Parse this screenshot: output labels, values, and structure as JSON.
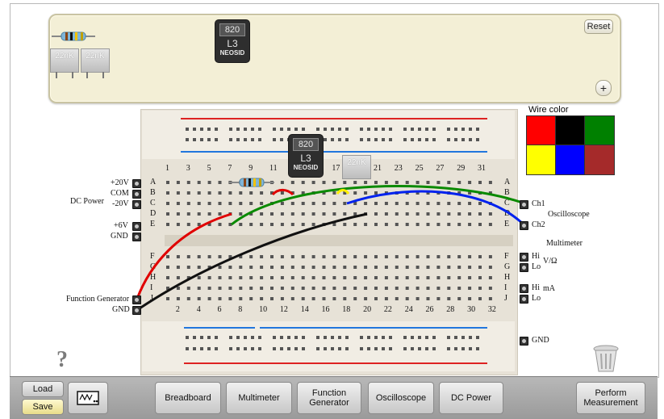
{
  "tray": {
    "reset_label": "Reset",
    "add_label": "+",
    "cap1_label": "22nK",
    "cap2_label": "22nK"
  },
  "inductor": {
    "code": "820",
    "name": "L3",
    "brand": "NEOSID"
  },
  "board_capacitor_label": "22nK",
  "columns_top": [
    "1",
    "3",
    "5",
    "7",
    "9",
    "11",
    "13",
    "15",
    "17",
    "19",
    "21",
    "23",
    "25",
    "27",
    "29",
    "31"
  ],
  "columns_bottom": [
    "2",
    "4",
    "6",
    "8",
    "10",
    "12",
    "14",
    "16",
    "18",
    "20",
    "22",
    "24",
    "26",
    "28",
    "30",
    "32"
  ],
  "rows_top": [
    "A",
    "B",
    "C",
    "D",
    "E"
  ],
  "rows_bottom": [
    "F",
    "G",
    "H",
    "I",
    "J"
  ],
  "left_labels": {
    "plus20": "+20V",
    "com": "COM",
    "minus20": "-20V",
    "dc_power": "DC Power",
    "plus6": "+6V",
    "gnd": "GND",
    "function_generator": "Function Generator",
    "fg_gnd": "GND"
  },
  "right_labels": {
    "ch1": "Ch1",
    "ch2": "Ch2",
    "oscilloscope": "Oscilloscope",
    "multimeter": "Multimeter",
    "hi1": "Hi",
    "lo1": "Lo",
    "volt_ohm": "V/Ω",
    "hi2": "Hi",
    "lo2": "Lo",
    "ma": "mA",
    "gnd": "GND"
  },
  "wire_color": {
    "title": "Wire color",
    "colors": [
      "#ff0000",
      "#000000",
      "#008000",
      "#ffff00",
      "#0000ff",
      "#a52a2a"
    ]
  },
  "help_label": "?",
  "toolbar": {
    "load": "Load",
    "save": "Save",
    "breadboard": "Breadboard",
    "multimeter": "Multimeter",
    "function_generator": "Function Generator",
    "oscilloscope": "Oscilloscope",
    "dc_power": "DC Power",
    "perform_measurement": "Perform Measurement"
  }
}
